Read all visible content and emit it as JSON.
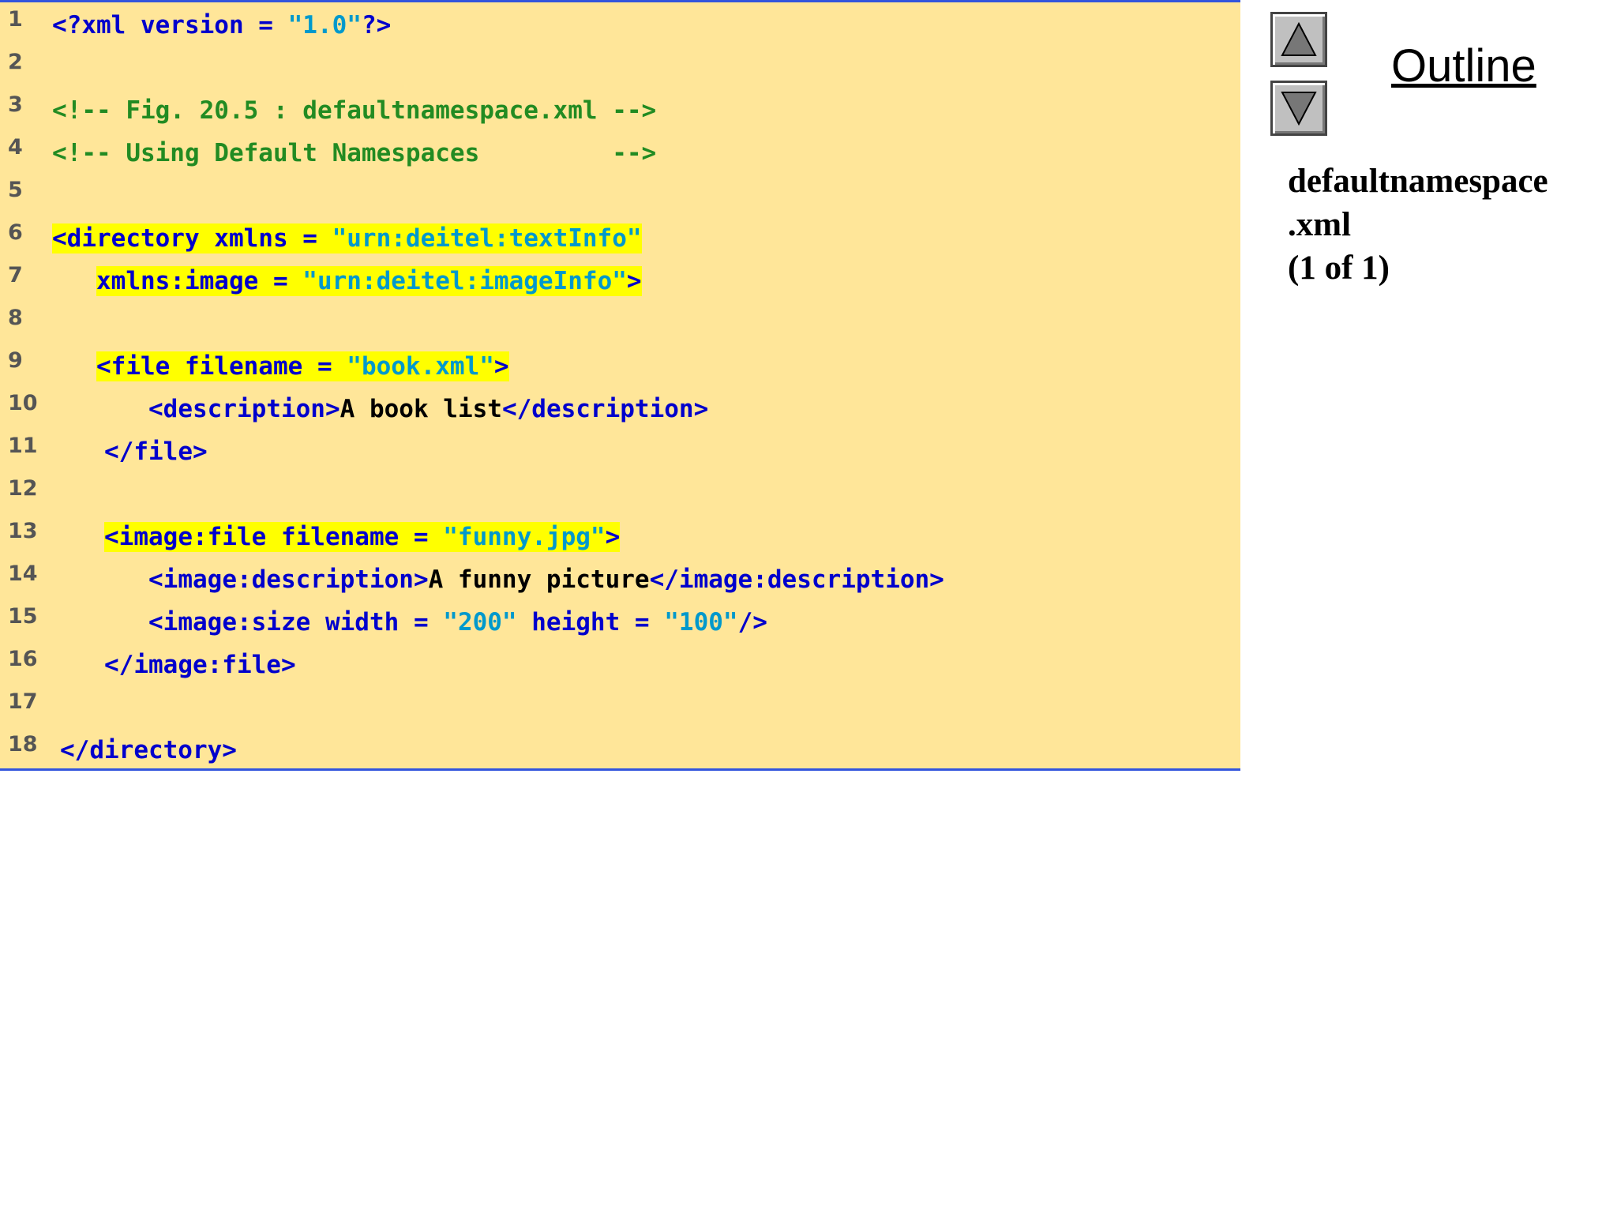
{
  "code_lines": [
    {
      "n": "1",
      "segments": [
        [
          "t",
          "<?xml version = "
        ],
        [
          "v",
          "\"1.0\""
        ],
        [
          "t",
          "?>"
        ]
      ]
    },
    {
      "n": "2",
      "segments": []
    },
    {
      "n": "3",
      "segments": [
        [
          "c",
          "<!-- Fig. 20.5 : defaultnamespace.xml -->"
        ]
      ]
    },
    {
      "n": "4",
      "segments": [
        [
          "c",
          "<!-- Using Default Namespaces         -->"
        ]
      ]
    },
    {
      "n": "5",
      "segments": []
    },
    {
      "n": "6",
      "segments": [
        [
          "t",
          "<directory xmlns = "
        ],
        [
          "v",
          "\"urn:deitel:textInfo\""
        ]
      ]
    },
    {
      "n": "7",
      "segments": [
        [
          "t",
          "xmlns:image = "
        ],
        [
          "v",
          "\"urn:deitel:imageInfo\""
        ],
        [
          "t",
          ">"
        ]
      ]
    },
    {
      "n": "8",
      "segments": []
    },
    {
      "n": "9",
      "segments": [
        [
          "t",
          "<file filename = "
        ],
        [
          "v",
          "\"book.xml\""
        ],
        [
          "t",
          ">"
        ]
      ]
    },
    {
      "n": "10",
      "segments": [
        [
          "t",
          "<description>"
        ],
        [
          "x",
          "A book list"
        ],
        [
          "t",
          "</description>"
        ]
      ]
    },
    {
      "n": "11",
      "segments": [
        [
          "t",
          "</file>"
        ]
      ]
    },
    {
      "n": "12",
      "segments": []
    },
    {
      "n": "13",
      "segments": [
        [
          "t",
          "<image:file filename = "
        ],
        [
          "v",
          "\"funny.jpg\""
        ],
        [
          "t",
          ">"
        ]
      ]
    },
    {
      "n": "14",
      "segments": [
        [
          "t",
          "<image:description>"
        ],
        [
          "x",
          "A funny picture"
        ],
        [
          "t",
          "</image:description>"
        ]
      ]
    },
    {
      "n": "15",
      "segments": [
        [
          "t",
          "<image:size width = "
        ],
        [
          "v",
          "\"200\""
        ],
        [
          "t",
          " height = "
        ],
        [
          "v",
          "\"100\""
        ],
        [
          "t",
          "/>"
        ]
      ]
    },
    {
      "n": "16",
      "segments": [
        [
          "t",
          "</image:file>"
        ]
      ]
    },
    {
      "n": "17",
      "segments": []
    },
    {
      "n": "18",
      "segments": [
        [
          "t",
          "</directory>"
        ]
      ]
    }
  ],
  "sidebar": {
    "title": "Outline",
    "file_label_line1": "defaultnamespace",
    "file_label_line2": ".xml",
    "file_label_line3": "(1 of 1)",
    "up_icon": "triangle-up-icon",
    "down_icon": "triangle-down-icon"
  },
  "colors": {
    "panel_bg": "#ffe699",
    "panel_border": "#3355dd",
    "highlight": "#ffff00",
    "tag": "#0000cc",
    "value": "#0099cc",
    "comment": "#228b22"
  }
}
